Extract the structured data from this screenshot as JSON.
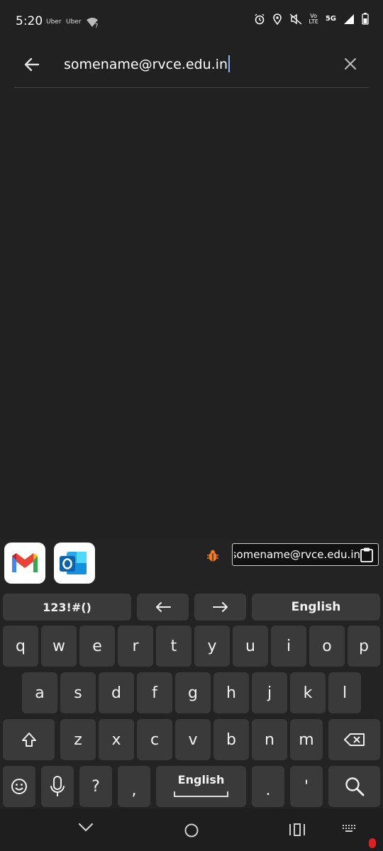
{
  "status_bar": {
    "time": "5:20",
    "app_labels": [
      "Uber",
      "Uber"
    ],
    "network_label_top": "Vo",
    "network_label_bottom": "LTE",
    "network_type": "5G"
  },
  "search": {
    "query": "somename@rvce.edu.in"
  },
  "keyboard": {
    "suggestions": {
      "apps": [
        "Gmail",
        "Outlook"
      ],
      "clipboard_text": "somename@rvce.edu.in"
    },
    "top_row": {
      "symbols_label": "123!#()",
      "language_label": "English"
    },
    "rows": [
      [
        "q",
        "w",
        "e",
        "r",
        "t",
        "y",
        "u",
        "i",
        "o",
        "p"
      ],
      [
        "a",
        "s",
        "d",
        "f",
        "g",
        "h",
        "j",
        "k",
        "l"
      ],
      [
        "z",
        "x",
        "c",
        "v",
        "b",
        "n",
        "m"
      ]
    ],
    "bottom_row": {
      "question": "?",
      "comma": ",",
      "space_label": "English",
      "period": ".",
      "apostrophe": "'"
    }
  },
  "colors": {
    "background": "#212121",
    "key": "#3a3a3a",
    "cursor": "#8ab4f8",
    "recording_dot": "#e02020"
  }
}
